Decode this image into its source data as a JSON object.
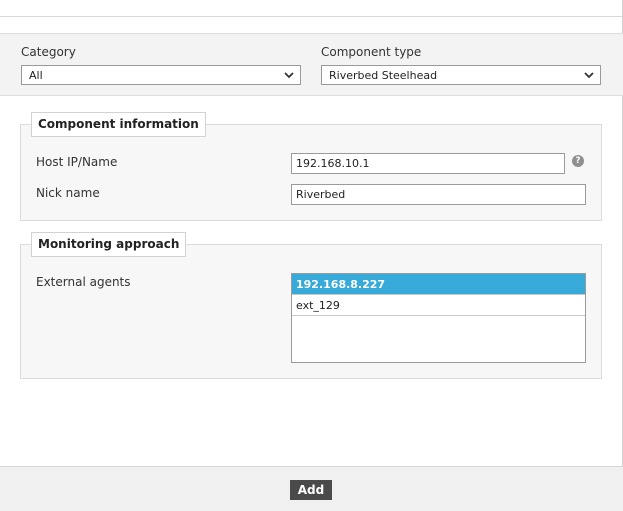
{
  "filters": {
    "category_label": "Category",
    "category_value": "All",
    "component_type_label": "Component type",
    "component_type_value": "Riverbed Steelhead"
  },
  "component_info": {
    "legend": "Component information",
    "host_label": "Host IP/Name",
    "host_value": "192.168.10.1",
    "help_glyph": "?",
    "nick_label": "Nick name",
    "nick_value": "Riverbed"
  },
  "monitoring": {
    "legend": "Monitoring approach",
    "agents_label": "External agents",
    "agents": [
      {
        "label": "192.168.8.227",
        "selected": true
      },
      {
        "label": "ext_129",
        "selected": false
      }
    ]
  },
  "footer": {
    "add_label": "Add"
  },
  "colors": {
    "selected_row": "#38aad9",
    "button_bg": "#4a4a4a"
  },
  "icons": {
    "chevron": "chevron-down-icon",
    "help": "help-icon"
  }
}
